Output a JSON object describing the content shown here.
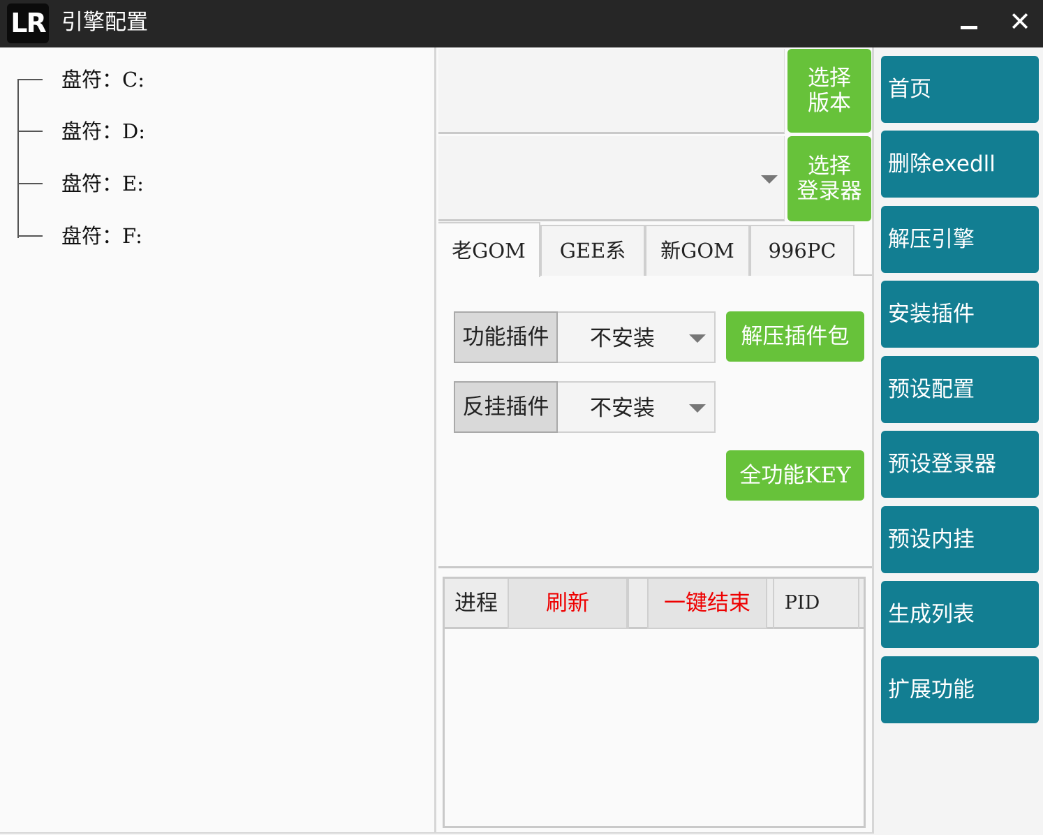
{
  "titlebar": {
    "logo_text": "LR",
    "title": "引擎配置",
    "close_glyph": "✕"
  },
  "tree": {
    "items": [
      {
        "label": "盘符：C:"
      },
      {
        "label": "盘符：D:"
      },
      {
        "label": "盘符：E:"
      },
      {
        "label": "盘符：F:"
      }
    ]
  },
  "version": {
    "value": "",
    "button_line1": "选择",
    "button_line2": "版本"
  },
  "login": {
    "value": "",
    "button_line1": "选择",
    "button_line2": "登录器"
  },
  "tabs": [
    {
      "label": "老GOM",
      "active": true
    },
    {
      "label": "GEE系",
      "active": false
    },
    {
      "label": "新GOM",
      "active": false
    },
    {
      "label": "996PC",
      "active": false
    }
  ],
  "plugins": {
    "function_label": "功能插件",
    "function_value": "不安装",
    "anticheat_label": "反挂插件",
    "anticheat_value": "不安装",
    "unzip_button": "解压插件包",
    "key_button": "全功能KEY"
  },
  "process": {
    "col_process": "进程",
    "refresh": "刷新",
    "kill_all": "一键结束",
    "col_pid": "PID"
  },
  "nav": [
    {
      "label": "首页"
    },
    {
      "label": "删除exedll"
    },
    {
      "label": "解压引擎"
    },
    {
      "label": "安装插件"
    },
    {
      "label": "预设配置"
    },
    {
      "label": "预设登录器"
    },
    {
      "label": "预设内挂"
    },
    {
      "label": "生成列表"
    },
    {
      "label": "扩展功能"
    }
  ],
  "colors": {
    "titlebar": "#262626",
    "green": "#67c23a",
    "teal": "#127e92",
    "red_text": "#ee0000"
  }
}
